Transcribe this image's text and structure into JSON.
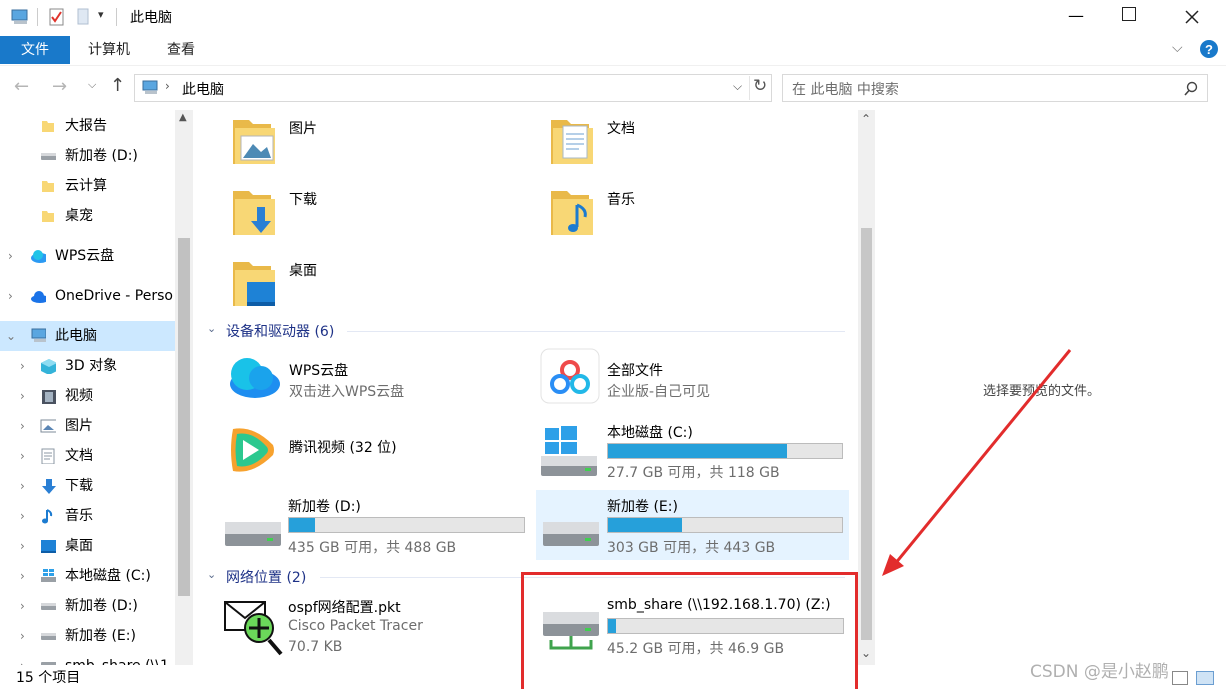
{
  "window": {
    "title": "此电脑",
    "controls": [
      "minimize",
      "maximize",
      "close"
    ]
  },
  "ribbon": {
    "tabs": [
      "文件",
      "计算机",
      "查看"
    ]
  },
  "address": {
    "path": "此电脑",
    "search_placeholder": "在 此电脑 中搜索"
  },
  "nav": {
    "items": [
      {
        "label": "大报告",
        "icon": "folder-icon"
      },
      {
        "label": "新加卷 (D:)",
        "icon": "drive-icon"
      },
      {
        "label": "云计算",
        "icon": "folder-icon"
      },
      {
        "label": "桌宠",
        "icon": "folder-icon"
      },
      {
        "label": "WPS云盘",
        "icon": "cloud-icon"
      },
      {
        "label": "OneDrive - Perso",
        "icon": "onedrive-icon"
      },
      {
        "label": "此电脑",
        "icon": "computer-icon"
      },
      {
        "label": "3D 对象",
        "icon": "3d-icon"
      },
      {
        "label": "视频",
        "icon": "video-icon"
      },
      {
        "label": "图片",
        "icon": "picture-icon"
      },
      {
        "label": "文档",
        "icon": "document-icon"
      },
      {
        "label": "下载",
        "icon": "download-icon"
      },
      {
        "label": "音乐",
        "icon": "music-icon"
      },
      {
        "label": "桌面",
        "icon": "desktop-icon"
      },
      {
        "label": "本地磁盘 (C:)",
        "icon": "windows-drive-icon"
      },
      {
        "label": "新加卷 (D:)",
        "icon": "drive-icon"
      },
      {
        "label": "新加卷 (E:)",
        "icon": "drive-icon"
      },
      {
        "label": "smb_share (\\\\1",
        "icon": "network-drive-icon"
      }
    ]
  },
  "folders": [
    {
      "label": "图片"
    },
    {
      "label": "文档"
    },
    {
      "label": "下载"
    },
    {
      "label": "音乐"
    },
    {
      "label": "桌面"
    }
  ],
  "groups": {
    "devices": "设备和驱动器 (6)",
    "network": "网络位置 (2)"
  },
  "devices": {
    "wps": {
      "title": "WPS云盘",
      "sub": "双击进入WPS云盘"
    },
    "all_files": {
      "title": "全部文件",
      "sub": "企业版-自己可见"
    },
    "tencent": {
      "title": "腾讯视频 (32 位)"
    },
    "c": {
      "title": "本地磁盘 (C:)",
      "sub": "27.7 GB 可用，共 118 GB",
      "used": 0.765
    },
    "d": {
      "title": "新加卷 (D:)",
      "sub": "435 GB 可用，共 488 GB",
      "used": 0.109
    },
    "e": {
      "title": "新加卷 (E:)",
      "sub": "303 GB 可用，共 443 GB",
      "used": 0.316
    }
  },
  "network": {
    "ospf": {
      "title": "ospf网络配置.pkt",
      "sub": "Cisco Packet Tracer",
      "size": "70.7 KB"
    },
    "smb": {
      "title": "smb_share (\\\\192.168.1.70) (Z:)",
      "sub": "45.2 GB 可用，共 46.9 GB",
      "used": 0.036
    }
  },
  "preview": {
    "text": "选择要预览的文件。"
  },
  "status": {
    "count": "15 个项目"
  },
  "watermark": "CSDN @是小赵鹏"
}
